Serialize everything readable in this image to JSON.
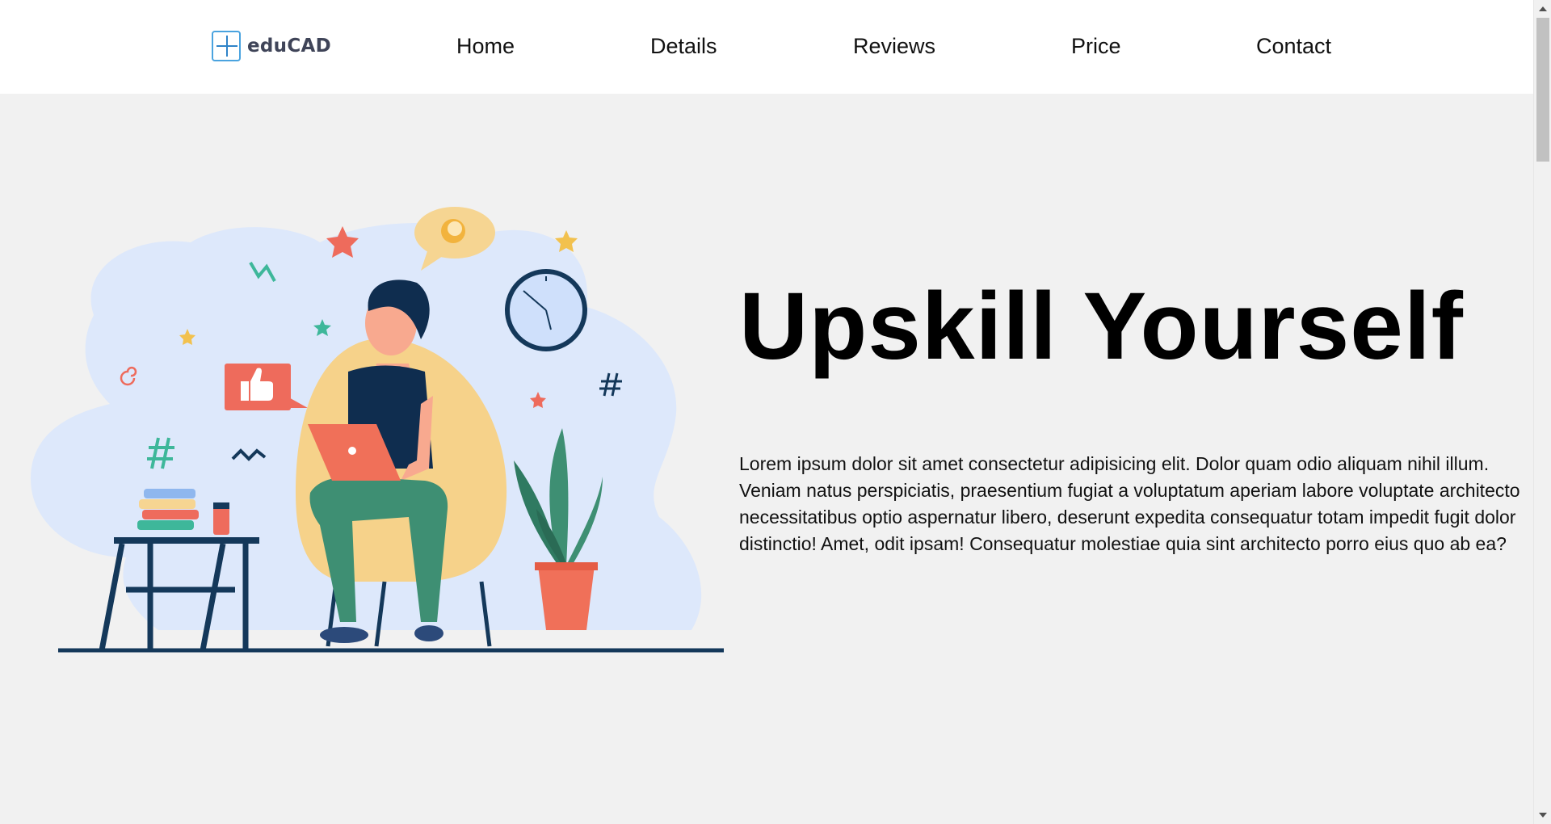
{
  "logo": {
    "text": "eduCAD",
    "icon": "crosshair-logo-icon"
  },
  "nav": {
    "home": "Home",
    "details": "Details",
    "reviews": "Reviews",
    "price": "Price",
    "contact": "Contact"
  },
  "hero": {
    "title": "Upskill Yourself",
    "description": "Lorem ipsum dolor sit amet consectetur adipisicing elit. Dolor quam odio aliquam nihil illum. Veniam natus perspiciatis, praesentium fugiat a voluptatum aperiam labore voluptate architecto necessitatibus optio aspernatur libero, deserunt expedita consequatur totam impedit fugit dolor distinctio! Amet, odit ipsam! Consequatur molestiae quia sint architecto porro eius quo ab ea?",
    "illustration": "person-studying-on-laptop-illustration"
  },
  "colors": {
    "background": "#f1f1f1",
    "header": "#ffffff",
    "accent_blue": "#4aa3df",
    "coral": "#f07059",
    "navy": "#14385a",
    "green": "#3e8f73"
  }
}
